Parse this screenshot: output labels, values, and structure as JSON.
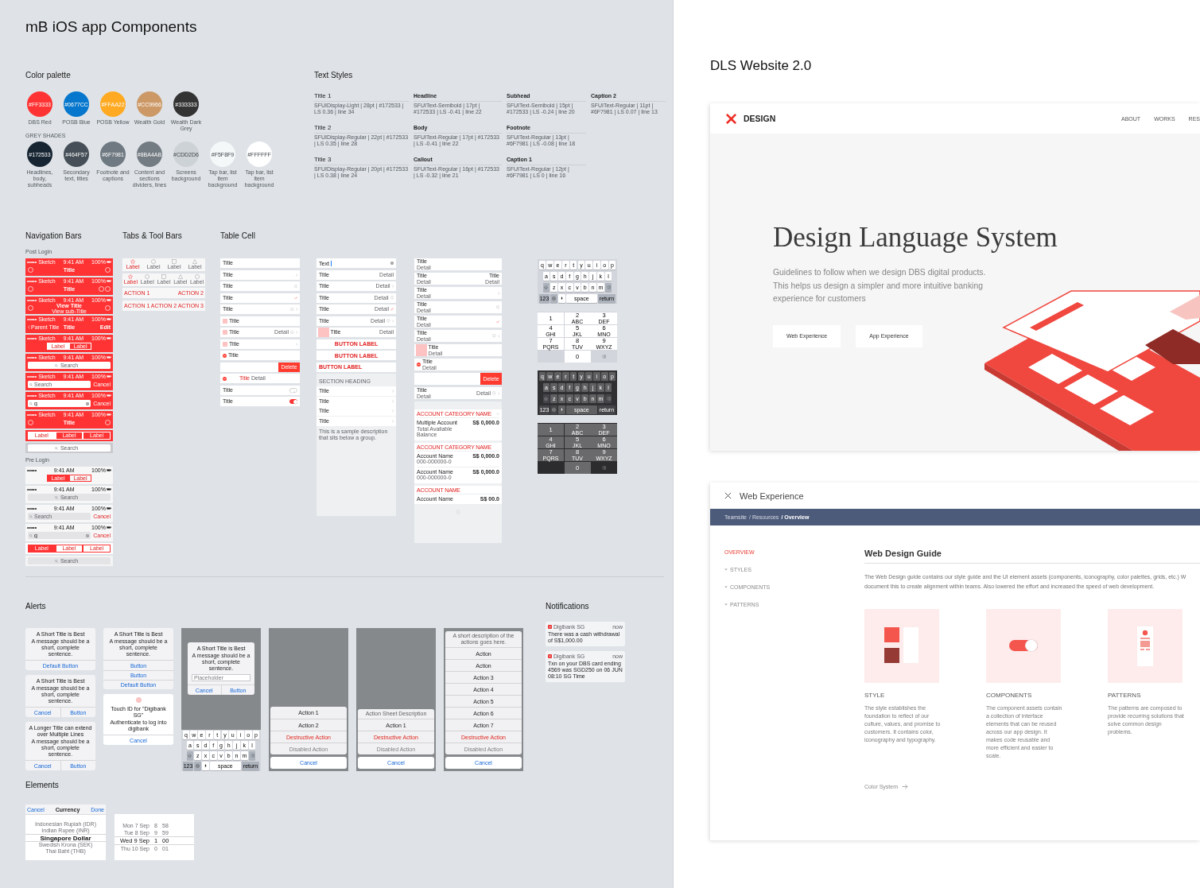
{
  "board": {
    "title": "mB iOS app Components"
  },
  "color_palette": {
    "title": "Color palette",
    "primary": [
      {
        "hex": "#FF3333",
        "label": "DBS Red",
        "color": "#ff3333"
      },
      {
        "hex": "#0677CC",
        "label": "POSB Blue",
        "color": "#0677cc"
      },
      {
        "hex": "#FFAA22",
        "label": "POSB Yellow",
        "color": "#ffaa22"
      },
      {
        "hex": "#CC9966",
        "label": "Wealth Gold",
        "color": "#cc9966"
      },
      {
        "hex": "#333333",
        "label": "Wealth Dark Grey",
        "color": "#333333"
      }
    ],
    "group_label": "GREY SHADES",
    "greys": [
      {
        "hex": "#172533",
        "label": "Headlines, body, subheads",
        "color": "#172533"
      },
      {
        "hex": "#464F57",
        "label": "Secondary text, titles",
        "color": "#464f57"
      },
      {
        "hex": "#6F7981",
        "label": "Footnote and captions",
        "color": "#6f7981"
      },
      {
        "hex": "#8BA4AB",
        "label": "Content and sections dividers, lines",
        "color": "#737b83"
      },
      {
        "hex": "#CDD2D6",
        "label": "Screens background",
        "color": "#cdd2d6"
      },
      {
        "hex": "#F5F8F9",
        "label": "Tap bar, list item background",
        "color": "#f5f8f9"
      },
      {
        "hex": "#FFFFFF",
        "label": "Tap bar, list item background",
        "color": "#ffffff"
      }
    ]
  },
  "text_styles": {
    "title": "Text Styles",
    "columns": [
      [
        {
          "name": "Title 1",
          "spec": "SFUIDisplay-Light | 28pt | #172533 | LS 0.36 | line 34"
        },
        {
          "name": "Title 2",
          "spec": "SFUIDisplay-Regular | 22pt | #172533 | LS 0.35 | line 28"
        },
        {
          "name": "Title 3",
          "spec": "SFUIDisplay-Regular | 20pt | #172533 | LS 0.38 | line 24"
        }
      ],
      [
        {
          "name": "Headline",
          "spec": "SFUIText-Semibold | 17pt | #172533 | LS -0.41 | line 22"
        },
        {
          "name": "Body",
          "spec": "SFUIText-Regular | 17pt | #172533 | LS -0.41 | line 22"
        },
        {
          "name": "Callout",
          "spec": "SFUIText-Regular | 16pt | #172533 | LS -0.32 | line 21"
        }
      ],
      [
        {
          "name": "Subhead",
          "spec": "SFUIText-Semibold | 15pt | #172533 | LS -0.24 | line 20"
        },
        {
          "name": "Footnote",
          "spec": "SFUIText-Regular | 13pt | #6F7981 | LS -0.08 | line 18"
        },
        {
          "name": "Caption 1",
          "spec": "SFUIText-Regular | 12pt | #6F7981 | LS 0 | line 16"
        }
      ],
      [
        {
          "name": "Caption 2",
          "spec": "SFUIText-Regular | 11pt | #6F7981 | LS 0.07 | line 13"
        }
      ]
    ]
  },
  "navigation_bars": {
    "title": "Navigation Bars",
    "groups": [
      {
        "label": "Post Login",
        "filled": true,
        "bars": [
          {
            "kind": "title",
            "status": {
              "carrier": "••••• Sketch",
              "time": "9:41 AM",
              "battery": "100%"
            },
            "title": "Title"
          },
          {
            "kind": "title-two-actions",
            "status": {
              "carrier": "••••• Sketch",
              "time": "9:41 AM",
              "battery": "100%"
            },
            "title": "Title"
          },
          {
            "kind": "subtitle",
            "status": {
              "carrier": "••••• Sketch",
              "time": "9:41 AM",
              "battery": "100%"
            },
            "title": "View Title",
            "subtitle": "View sub-Title"
          },
          {
            "kind": "back",
            "status": {
              "carrier": "••••• Sketch",
              "time": "9:41 AM",
              "battery": "100%"
            },
            "back": "Parent Title",
            "title": "Title",
            "action": "Edit"
          },
          {
            "kind": "segmented",
            "status": {
              "carrier": "••••• Sketch",
              "time": "9:41 AM",
              "battery": "100%"
            },
            "segments": [
              {
                "label": "Label",
                "selected": true
              },
              {
                "label": "Label",
                "selected": false
              }
            ]
          },
          {
            "kind": "search",
            "status": {
              "carrier": "••••• Sketch",
              "time": "9:41 AM",
              "battery": "100%"
            },
            "placeholder": "Search"
          },
          {
            "kind": "search-cancel",
            "status": {
              "carrier": "••••• Sketch",
              "time": "9:41 AM",
              "battery": "100%"
            },
            "placeholder": "Search",
            "cancel": "Cancel"
          },
          {
            "kind": "search-typed",
            "status": {
              "carrier": "••••• Sketch",
              "time": "9:41 AM",
              "battery": "100%"
            },
            "value": "g",
            "cancel": "Cancel"
          },
          {
            "kind": "title",
            "status": {
              "carrier": "••••• Sketch",
              "time": "9:41 AM",
              "battery": "100%"
            },
            "title": "Title"
          },
          {
            "kind": "segmented",
            "segments": [
              {
                "label": "Label",
                "selected": true
              },
              {
                "label": "Label",
                "selected": false
              },
              {
                "label": "Label",
                "selected": false
              }
            ]
          },
          {
            "kind": "search-bar",
            "placeholder": "Search"
          }
        ]
      },
      {
        "label": "Pre Login",
        "filled": false,
        "bars": [
          {
            "kind": "segmented",
            "status": {
              "carrier": "•••••",
              "time": "9:41 AM",
              "battery": "100%"
            },
            "segments": [
              {
                "label": "Label",
                "selected": true
              },
              {
                "label": "Label",
                "selected": false
              }
            ]
          },
          {
            "kind": "search",
            "status": {
              "carrier": "•••••",
              "time": "9:41 AM",
              "battery": "100%"
            },
            "placeholder": "Search"
          },
          {
            "kind": "search-cancel",
            "status": {
              "carrier": "•••••",
              "time": "9:41 AM",
              "battery": "100%"
            },
            "placeholder": "Search",
            "cancel": "Cancel"
          },
          {
            "kind": "search-typed",
            "status": {
              "carrier": "•••••",
              "time": "9:41 AM",
              "battery": "100%"
            },
            "value": "g",
            "cancel": "Cancel"
          },
          {
            "kind": "segmented",
            "segments": [
              {
                "label": "Label",
                "selected": true
              },
              {
                "label": "Label",
                "selected": false
              },
              {
                "label": "Label",
                "selected": false
              }
            ]
          },
          {
            "kind": "search-bar",
            "placeholder": "Search"
          }
        ]
      }
    ]
  },
  "tab_bars": {
    "title": "Tabs & Tool Bars",
    "bars": [
      {
        "kind": "tabs",
        "items": [
          {
            "kind": "star",
            "label": "Label",
            "selected": true
          },
          {
            "kind": "circle",
            "label": "Label",
            "selected": false
          },
          {
            "kind": "square",
            "label": "Label",
            "selected": false
          },
          {
            "kind": "triangle",
            "label": "Label",
            "selected": false
          }
        ]
      },
      {
        "kind": "tabs",
        "items": [
          {
            "kind": "star",
            "label": "Label",
            "selected": true
          },
          {
            "kind": "circle",
            "label": "Label",
            "selected": false
          },
          {
            "kind": "square",
            "label": "Label",
            "selected": false
          },
          {
            "kind": "triangle",
            "label": "Label",
            "selected": false
          },
          {
            "kind": "circle",
            "label": "Label",
            "selected": false
          }
        ]
      },
      {
        "kind": "toolbar",
        "actions": [
          "ACTION 1",
          "ACTION 2"
        ]
      },
      {
        "kind": "toolbar",
        "actions": [
          "ACTION 1",
          "ACTION 2",
          "ACTION 3"
        ]
      }
    ]
  },
  "table_cells": {
    "title": "Table Cell",
    "columns": [
      {
        "cells": [
          {
            "kind": "plain",
            "title": "Title"
          },
          {
            "kind": "plain",
            "title": "Title",
            "accessories": [
              {
                "kind": "chevron"
              }
            ]
          },
          {
            "kind": "plain",
            "title": "Title",
            "accessories": [
              {
                "kind": "info"
              }
            ]
          },
          {
            "kind": "plain",
            "title": "Title",
            "accessories": [
              {
                "kind": "check"
              }
            ]
          },
          {
            "kind": "plain",
            "title": "Title",
            "accessories": [
              {
                "kind": "info"
              },
              {
                "kind": "chevron"
              }
            ]
          },
          {
            "kind": "thumb",
            "title": "Title"
          },
          {
            "kind": "thumb",
            "title": "Title",
            "detail": "Detail",
            "accessories": [
              {
                "kind": "info"
              },
              {
                "kind": "chevron"
              }
            ]
          },
          {
            "kind": "thumb",
            "title": "Title",
            "accessories": [
              {
                "kind": "chevron"
              }
            ]
          },
          {
            "kind": "delete-control",
            "title": "Title"
          },
          {
            "kind": "swipe",
            "action": "Delete"
          },
          {
            "kind": "editing",
            "title": "Title",
            "detail": "Detail"
          },
          {
            "kind": "plain",
            "title": "Title",
            "accessories": [
              {
                "kind": "switch",
                "on": false
              }
            ]
          },
          {
            "kind": "plain",
            "title": "Title",
            "accessories": [
              {
                "kind": "switch",
                "on": true
              }
            ]
          }
        ]
      },
      {
        "cells": [
          {
            "kind": "text-field",
            "value": "Text"
          },
          {
            "kind": "plain",
            "title": "Title",
            "detail": "Detail"
          },
          {
            "kind": "plain",
            "title": "Title",
            "detail": "Detail",
            "accessories": [
              {
                "kind": "chevron"
              }
            ]
          },
          {
            "kind": "plain",
            "title": "Title",
            "detail": "Detail",
            "accessories": [
              {
                "kind": "info"
              }
            ]
          },
          {
            "kind": "plain",
            "title": "Title",
            "detail": "Detail",
            "accessories": [
              {
                "kind": "check"
              }
            ]
          },
          {
            "kind": "plain",
            "title": "Title",
            "detail": "Detail",
            "accessories": [
              {
                "kind": "info"
              },
              {
                "kind": "chevron"
              }
            ]
          },
          {
            "kind": "thumb",
            "title": "Title",
            "detail": "Detail"
          },
          {
            "kind": "button",
            "label": "BUTTON LABEL",
            "centered": true
          },
          {
            "kind": "button",
            "label": "BUTTON LABEL",
            "centered": true
          },
          {
            "kind": "button",
            "label": "BUTTON LABEL",
            "centered": false
          },
          {
            "kind": "section",
            "heading": "SECTION HEADING",
            "rows": [
              {
                "title": "Title",
                "accessories": [
                  {
                    "kind": "chevron"
                  }
                ]
              },
              {
                "title": "Title",
                "accessories": [
                  {
                    "kind": "chevron"
                  }
                ]
              },
              {
                "title": "Title",
                "accessories": [
                  {
                    "kind": "chevron"
                  }
                ]
              },
              {
                "title": "Title",
                "accessories": [
                  {
                    "kind": "chevron"
                  }
                ]
              }
            ],
            "footer": "This is a sample description that sits below a group."
          }
        ]
      },
      {
        "cells": [
          {
            "kind": "plain",
            "title": "Title",
            "subtitle": "Detail"
          },
          {
            "kind": "plain",
            "title": "Title",
            "subtitle": "Detail",
            "right_title": "Title",
            "right_subtitle": "Detail"
          },
          {
            "kind": "plain",
            "title": "Title",
            "subtitle": "Detail",
            "accessories": [
              {
                "kind": "chevron"
              }
            ]
          },
          {
            "kind": "plain",
            "title": "Title",
            "subtitle": "Detail",
            "accessories": [
              {
                "kind": "info"
              }
            ]
          },
          {
            "kind": "plain",
            "title": "Title",
            "subtitle": "Detail",
            "accessories": [
              {
                "kind": "check"
              }
            ]
          },
          {
            "kind": "plain",
            "title": "Title",
            "subtitle": "Detail",
            "accessories": [
              {
                "kind": "info"
              },
              {
                "kind": "chevron"
              }
            ]
          },
          {
            "kind": "thumb",
            "title": "Title",
            "subtitle": "Detail"
          },
          {
            "kind": "delete-control",
            "title": "Title",
            "subtitle": "Detail"
          },
          {
            "kind": "swipe",
            "action": "Delete"
          },
          {
            "kind": "plain",
            "title": "Title",
            "subtitle": "Detail",
            "detail": "Detail",
            "accessories": [
              {
                "kind": "info"
              },
              {
                "kind": "chevron"
              }
            ]
          },
          {
            "kind": "accounts",
            "groups": [
              {
                "heading": "ACCOUNT CATEGORY NAME",
                "toggle": true,
                "rows": [
                  {
                    "name": "Multiple Account",
                    "sub": "Total Available Balance",
                    "amount": "S$ 0,000.0"
                  }
                ]
              },
              {
                "heading": "ACCOUNT CATEGORY NAME",
                "toggle": false,
                "rows": [
                  {
                    "name": "Account Name",
                    "sub": "000-000000-0",
                    "amount": "S$ 0,000.0"
                  },
                  {
                    "name": "Account Name",
                    "sub": "000-000000-0",
                    "amount": "S$ 0,000.0"
                  }
                ]
              },
              {
                "heading": "ACCOUNT NAME",
                "toggle": false,
                "rows": [
                  {
                    "name": "Account Name",
                    "amount": "S$ 00.0"
                  }
                ]
              }
            ]
          }
        ]
      }
    ]
  },
  "keyboards": [
    {
      "kind": "qwerty",
      "dark": false,
      "rows": [
        [
          "q",
          "w",
          "e",
          "r",
          "t",
          "y",
          "u",
          "i",
          "o",
          "p"
        ],
        [
          "a",
          "s",
          "d",
          "f",
          "g",
          "h",
          "j",
          "k",
          "l"
        ],
        [
          "z",
          "x",
          "c",
          "v",
          "b",
          "n",
          "m"
        ]
      ],
      "numbers": "123",
      "space": "space",
      "return": "return"
    },
    {
      "kind": "numpad",
      "dark": false,
      "keys": [
        {
          "digit": "1"
        },
        {
          "digit": "2",
          "letters": "ABC"
        },
        {
          "digit": "3",
          "letters": "DEF"
        },
        {
          "digit": "4",
          "letters": "GHI"
        },
        {
          "digit": "5",
          "letters": "JKL"
        },
        {
          "digit": "6",
          "letters": "MNO"
        },
        {
          "digit": "7",
          "letters": "PQRS"
        },
        {
          "digit": "8",
          "letters": "TUV"
        },
        {
          "digit": "9",
          "letters": "WXYZ"
        },
        {
          "digit": "0"
        }
      ]
    },
    {
      "kind": "qwerty",
      "dark": true,
      "rows": [
        [
          "q",
          "w",
          "e",
          "r",
          "t",
          "y",
          "u",
          "i",
          "o",
          "p"
        ],
        [
          "a",
          "s",
          "d",
          "f",
          "g",
          "h",
          "j",
          "k",
          "l"
        ],
        [
          "z",
          "x",
          "c",
          "v",
          "b",
          "n",
          "m"
        ]
      ],
      "numbers": "123",
      "space": "space",
      "return": "return"
    },
    {
      "kind": "numpad",
      "dark": true,
      "keys": [
        {
          "digit": "1"
        },
        {
          "digit": "2",
          "letters": "ABC"
        },
        {
          "digit": "3",
          "letters": "DEF"
        },
        {
          "digit": "4",
          "letters": "GHI"
        },
        {
          "digit": "5",
          "letters": "JKL"
        },
        {
          "digit": "6",
          "letters": "MNO"
        },
        {
          "digit": "7",
          "letters": "PQRS"
        },
        {
          "digit": "8",
          "letters": "TUV"
        },
        {
          "digit": "9",
          "letters": "WXYZ"
        },
        {
          "digit": "0"
        }
      ]
    }
  ],
  "alerts": {
    "title": "Alerts",
    "columns": [
      [
        {
          "kind": "single",
          "title": "A Short Title is Best",
          "message": "A message should be a short, complete sentence.",
          "buttons": [
            "Default Button"
          ]
        },
        {
          "kind": "pair",
          "title": "A Short Title is Best",
          "message": "A message should be a short, complete sentence.",
          "buttons": [
            "Cancel",
            "Button"
          ]
        },
        {
          "kind": "pair",
          "title": "A Longer Title can extend over Multiple Lines",
          "message": "A message should be a short, complete sentence.",
          "buttons": [
            "Cancel",
            "Button"
          ]
        }
      ],
      [
        {
          "kind": "stacked",
          "title": "A Short Title is Best",
          "message": "A message should be a short, complete sentence.",
          "buttons": [
            "Button",
            "Button",
            "Default Button"
          ]
        },
        {
          "kind": "touch-id",
          "title": "Touch ID for \"Digibank SG\"",
          "message": "Authenticate to log into digibank",
          "buttons": [
            "Cancel"
          ]
        }
      ]
    ],
    "screens": [
      {
        "kind": "alert-input",
        "title": "A Short Title is Best",
        "message": "A message should be a short, complete sentence.",
        "placeholder": "Placeholder",
        "buttons": [
          "Cancel",
          "Button"
        ],
        "keyboard": {
          "kind": "qwerty",
          "dark": false,
          "rows": [
            [
              "q",
              "w",
              "e",
              "r",
              "t",
              "y",
              "u",
              "i",
              "o",
              "p"
            ],
            [
              "a",
              "s",
              "d",
              "f",
              "g",
              "h",
              "j",
              "k",
              "l"
            ],
            [
              "z",
              "x",
              "c",
              "v",
              "b",
              "n",
              "m"
            ]
          ],
          "numbers": "123",
          "space": "space",
          "return": "return"
        }
      },
      {
        "kind": "action-sheet",
        "actions": [
          {
            "label": "Action 1",
            "kind": "normal",
            "disabled": false
          },
          {
            "label": "Action 2",
            "kind": "normal",
            "disabled": false
          },
          {
            "label": "Destructive Action",
            "kind": "destructive",
            "disabled": false
          },
          {
            "label": "Disabled Action",
            "kind": "normal",
            "disabled": true
          }
        ],
        "cancel": "Cancel"
      },
      {
        "kind": "action-sheet",
        "description": "Action Sheet Description",
        "actions": [
          {
            "label": "Action 1",
            "kind": "normal",
            "disabled": false
          },
          {
            "label": "Destructive Action",
            "kind": "destructive",
            "disabled": false
          },
          {
            "label": "Disabled Action",
            "kind": "normal",
            "disabled": true
          }
        ],
        "cancel": "Cancel"
      },
      {
        "kind": "action-sheet",
        "description": "A short description of the actions goes here.",
        "actions": [
          {
            "label": "Action",
            "kind": "normal",
            "disabled": false
          },
          {
            "label": "Action",
            "kind": "normal",
            "disabled": false
          },
          {
            "label": "Action 3",
            "kind": "normal",
            "disabled": false
          },
          {
            "label": "Action 4",
            "kind": "normal",
            "disabled": false
          },
          {
            "label": "Action 5",
            "kind": "normal",
            "disabled": false
          },
          {
            "label": "Action 6",
            "kind": "normal",
            "disabled": false
          },
          {
            "label": "Action 7",
            "kind": "normal",
            "disabled": false
          },
          {
            "label": "Destructive Action",
            "kind": "destructive",
            "disabled": false
          },
          {
            "label": "Disabled Action",
            "kind": "normal",
            "disabled": true
          }
        ],
        "cancel": "Cancel"
      }
    ]
  },
  "notifications": {
    "title": "Notifications",
    "items": [
      {
        "app": "Digibank SG",
        "time": "now",
        "message": "There was a cash withdrawal of S$1,000.00"
      },
      {
        "app": "Digibank SG",
        "time": "now",
        "message": "Txn on your DBS card ending 4569 was SGD250 on 06 JUN 08:10 SG Time"
      }
    ]
  },
  "elements": {
    "title": "Elements",
    "pickers": [
      {
        "kind": "list",
        "cancel": "Cancel",
        "title": "Currency",
        "done": "Done",
        "rows": [
          {
            "label": "Indonesian Rupiah (IDR)",
            "selected": false
          },
          {
            "label": "Indian Rupee (INR)",
            "selected": false
          },
          {
            "label": "Singapore Dollar",
            "selected": true
          },
          {
            "label": "Swedish Krona (SEK)",
            "selected": false
          },
          {
            "label": "Thai Baht (THB)",
            "selected": false
          }
        ]
      },
      {
        "kind": "date",
        "rows": [
          {
            "cells": [
              "Mon 7 Sep",
              "8",
              "58"
            ],
            "selected": false
          },
          {
            "cells": [
              "Tue 8 Sep",
              "9",
              "59"
            ],
            "selected": false
          },
          {
            "cells": [
              "Wed 9 Sep",
              "1",
              "00"
            ],
            "selected": true
          },
          {
            "cells": [
              "Thu 10 Sep",
              "0",
              "01"
            ],
            "selected": false
          }
        ]
      }
    ]
  },
  "website": {
    "title": "DLS Website 2.0",
    "home": {
      "brand": "DESIGN",
      "nav": [
        "ABOUT",
        "WORKS",
        "RES"
      ],
      "heading": "Design Language System",
      "intro": "Guidelines to follow when we design DBS digital products. This helps us design a simpler and more intuitive banking experience for customers",
      "buttons": [
        "Web Experience",
        "App Experience"
      ]
    },
    "guide": {
      "title": "Web Experience",
      "breadcrumb": [
        {
          "label": "Teamsite",
          "current": false
        },
        {
          "label": "/ Resources",
          "current": false
        },
        {
          "label": "/ Overview",
          "current": true
        }
      ],
      "menu": [
        {
          "label": "OVERVIEW",
          "kind": "link",
          "selected": true
        },
        {
          "label": "STYLES",
          "kind": "group",
          "selected": false
        },
        {
          "label": "COMPONENTS",
          "kind": "group",
          "selected": false
        },
        {
          "label": "PATTERNS",
          "kind": "group",
          "selected": false
        }
      ],
      "heading": "Web Design Guide",
      "intro": "The Web Design guide contains our style guide and the UI element assets (components, iconography, color palettes, grids, etc.) W\ndocument this to create alignment within teams. Also lowered the effort and increased the speed of web development.",
      "cards": [
        {
          "kind": "style",
          "title": "STYLE",
          "text": "The style establishes the foundation to reflect of our culture, values, and promise to customers. It contains color, iconography and typography."
        },
        {
          "kind": "components",
          "title": "COMPONENTS",
          "text": "The component assets contain a collection of interface elements that can be reused across our app design. It makes code reusable and more efficient and easier to scale."
        },
        {
          "kind": "patterns",
          "title": "PATTERNS",
          "text": "The patterns are composed to provide recurring solutions that solve common design problems."
        }
      ],
      "next": "Color System"
    }
  }
}
